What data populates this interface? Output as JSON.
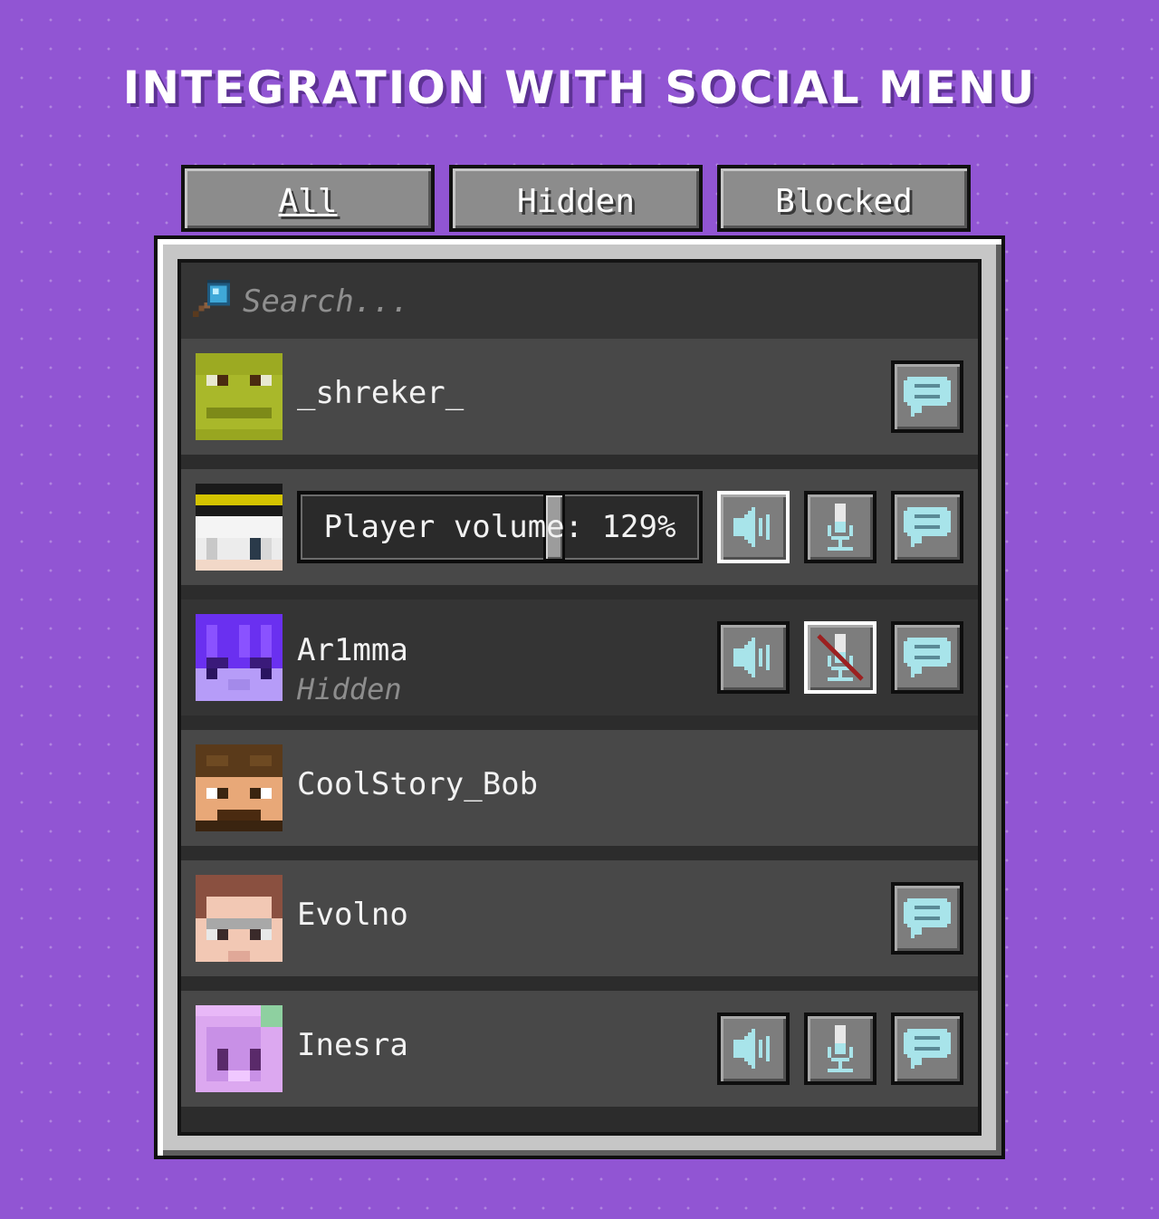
{
  "title": "INTEGRATION WITH SOCIAL MENU",
  "tabs": [
    {
      "label": "All",
      "active": true
    },
    {
      "label": "Hidden",
      "active": false
    },
    {
      "label": "Blocked",
      "active": false
    }
  ],
  "search": {
    "placeholder": "Search..."
  },
  "players": [
    {
      "name": "_shreker_",
      "buttons": [
        "chat-icon"
      ]
    },
    {
      "volume_label": "Player volume: 129%",
      "volume_percent": 129,
      "buttons": [
        "speaker-icon",
        "microphone-icon",
        "chat-icon"
      ]
    },
    {
      "name": "Ar1mma",
      "status": "Hidden",
      "buttons": [
        "speaker-icon",
        "microphone-muted-icon",
        "chat-icon"
      ]
    },
    {
      "name": "CoolStory_Bob",
      "buttons": []
    },
    {
      "name": "Evolno",
      "buttons": [
        "chat-icon"
      ]
    },
    {
      "name": "Inesra",
      "buttons": [
        "speaker-icon",
        "microphone-icon",
        "chat-icon"
      ]
    }
  ],
  "colors": {
    "background": "#9155d3",
    "accent_icon": "#a8e4ea",
    "mute_slash": "#9c2020"
  }
}
